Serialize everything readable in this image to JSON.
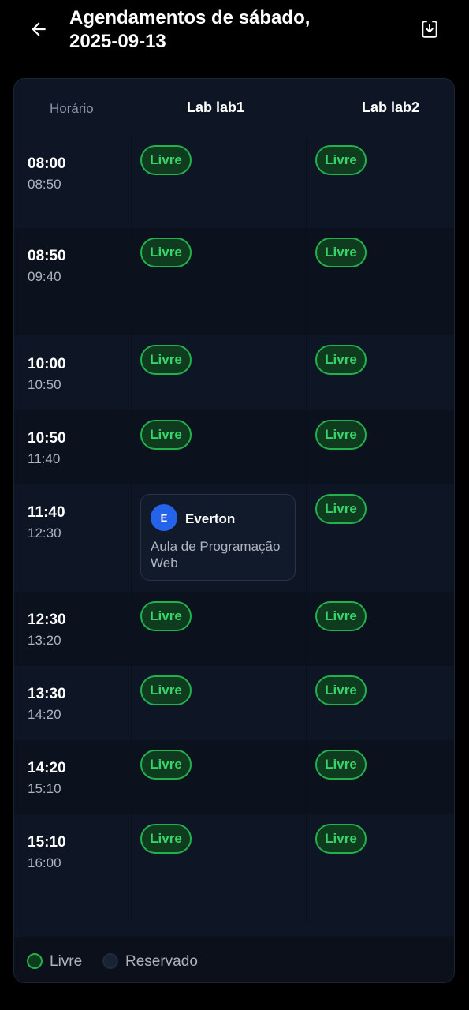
{
  "header": {
    "title_line1": "Agendamentos de sábado,",
    "title_line2": "2025-09-13",
    "back_icon": "arrow-left-icon",
    "download_icon": "download-icon"
  },
  "table": {
    "col_time": "Horário",
    "col_lab1": "Lab lab1",
    "col_lab2": "Lab lab2"
  },
  "rows": [
    {
      "start": "08:00",
      "end": "08:50",
      "lab1": "Livre",
      "lab2": "Livre"
    },
    {
      "start": "08:50",
      "end": "09:40",
      "lab1": "Livre",
      "lab2": "Livre"
    },
    {
      "start": "10:00",
      "end": "10:50",
      "lab1": "Livre",
      "lab2": "Livre"
    },
    {
      "start": "10:50",
      "end": "11:40",
      "lab1": "Livre",
      "lab2": "Livre"
    },
    {
      "start": "11:40",
      "end": "12:30",
      "lab2": "Livre",
      "booking": {
        "avatar_initial": "E",
        "name": "Everton",
        "description": "Aula de Programação Web"
      }
    },
    {
      "start": "12:30",
      "end": "13:20",
      "lab1": "Livre",
      "lab2": "Livre"
    },
    {
      "start": "13:30",
      "end": "14:20",
      "lab1": "Livre",
      "lab2": "Livre"
    },
    {
      "start": "14:20",
      "end": "15:10",
      "lab1": "Livre",
      "lab2": "Livre"
    },
    {
      "start": "15:10",
      "end": "16:00",
      "lab1": "Livre",
      "lab2": "Livre"
    }
  ],
  "legend": {
    "free": "Livre",
    "reserved": "Reservado"
  },
  "colors": {
    "free_green": "#22b14c",
    "avatar_blue": "#2563eb",
    "background": "#0e1626"
  }
}
